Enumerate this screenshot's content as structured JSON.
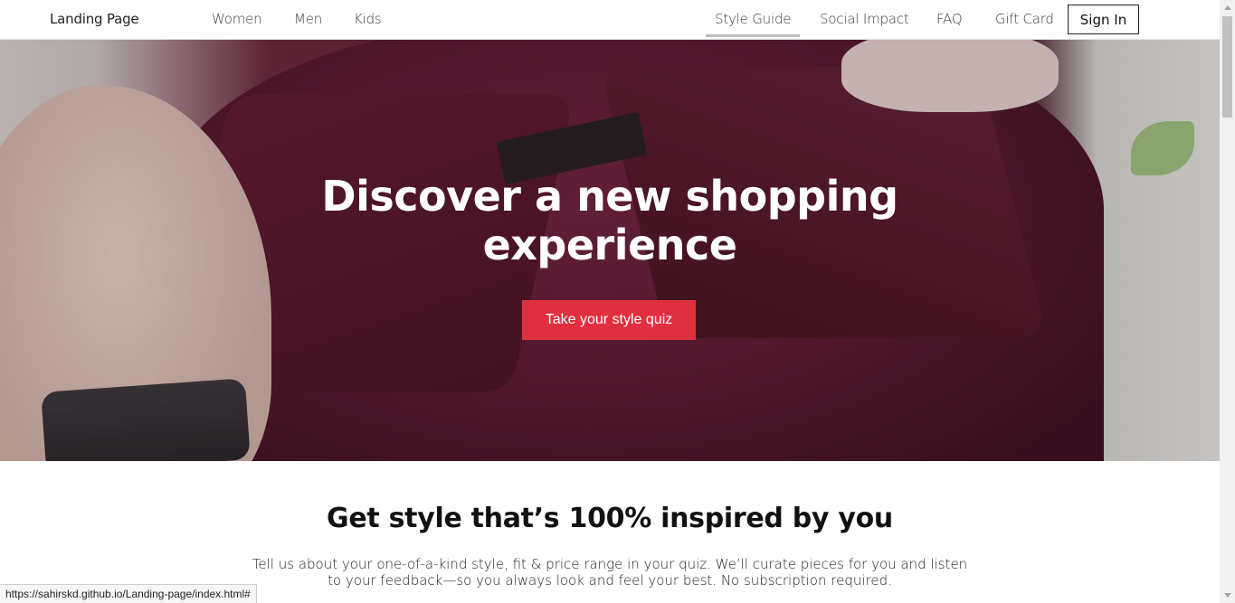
{
  "nav": {
    "brand": "Landing Page",
    "left_links": [
      "Women",
      "Men",
      "Kids"
    ],
    "right_links": [
      "Style Guide",
      "Social Impact",
      "FAQ",
      "Gift Card"
    ],
    "active_link": "Style Guide",
    "signin_label": "Sign In"
  },
  "hero": {
    "title_line1": "Discover a new shopping",
    "title_line2": "experience",
    "cta_label": "Take your style quiz"
  },
  "section": {
    "title": "Get style that’s 100% inspired by you",
    "body": "Tell us about your one-of-a-kind style, fit & price range in your quiz. We’ll curate pieces for you and listen to your feedback—so you always look and feel your best. No subscription required."
  },
  "status_bar": {
    "url": "https://sahirskd.github.io/Landing-page/index.html#"
  },
  "colors": {
    "cta": "#e0303f",
    "active_underline": "#bdbdbd"
  }
}
